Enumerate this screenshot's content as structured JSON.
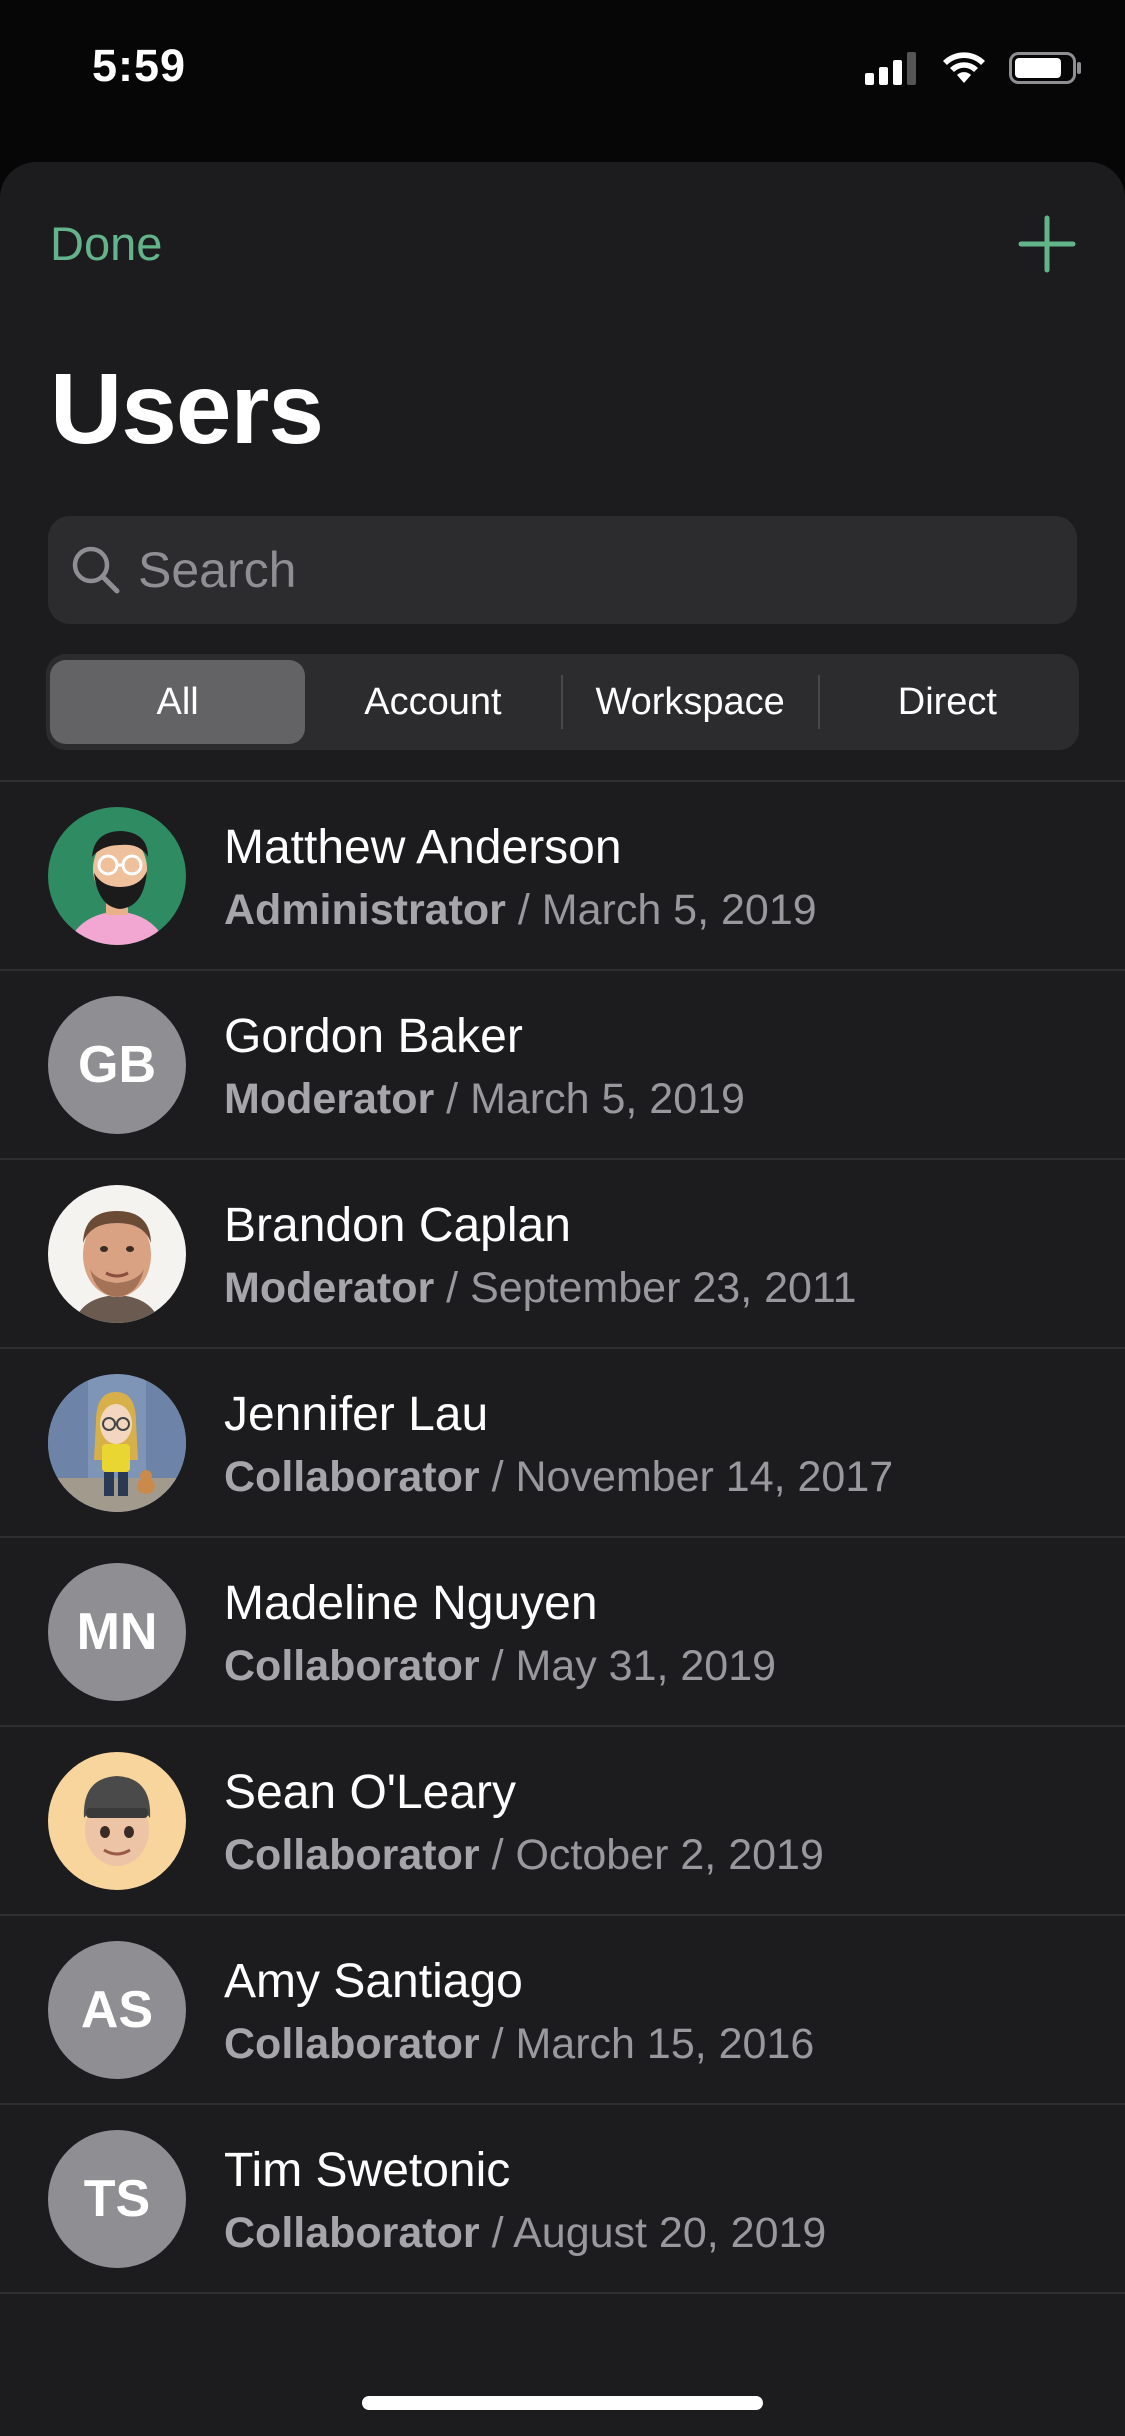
{
  "status_bar": {
    "time": "5:59",
    "icons": [
      "cellular-signal-icon",
      "wifi-icon",
      "battery-icon"
    ]
  },
  "nav": {
    "done_label": "Done",
    "add_icon": "plus-icon"
  },
  "title": "Users",
  "search": {
    "placeholder": "Search",
    "value": ""
  },
  "segments": [
    {
      "label": "All",
      "selected": true
    },
    {
      "label": "Account",
      "selected": false
    },
    {
      "label": "Workspace",
      "selected": false
    },
    {
      "label": "Direct",
      "selected": false
    }
  ],
  "separator": " / ",
  "users": [
    {
      "name": "Matthew Anderson",
      "role": "Administrator",
      "date": "March 5, 2019",
      "avatar": "illustrated-man-glasses-beard"
    },
    {
      "name": "Gordon Baker",
      "role": "Moderator",
      "date": "March 5, 2019",
      "avatar": "initials",
      "initials": "GB"
    },
    {
      "name": "Brandon Caplan",
      "role": "Moderator",
      "date": "September 23, 2011",
      "avatar": "photo-man"
    },
    {
      "name": "Jennifer Lau",
      "role": "Collaborator",
      "date": "November 14, 2017",
      "avatar": "illustrated-woman-with-dog"
    },
    {
      "name": "Madeline Nguyen",
      "role": "Collaborator",
      "date": "May 31, 2019",
      "avatar": "initials",
      "initials": "MN"
    },
    {
      "name": "Sean O'Leary",
      "role": "Collaborator",
      "date": "October 2, 2019",
      "avatar": "memoji-man-beanie"
    },
    {
      "name": "Amy Santiago",
      "role": "Collaborator",
      "date": "March 15, 2016",
      "avatar": "initials",
      "initials": "AS"
    },
    {
      "name": "Tim Swetonic",
      "role": "Collaborator",
      "date": "August 20, 2019",
      "avatar": "initials",
      "initials": "TS"
    }
  ],
  "colors": {
    "accent": "#63b48b",
    "sheet_background": "#1c1c1e",
    "field_background": "#2c2c2e",
    "initials_avatar": "#8e8e93"
  }
}
